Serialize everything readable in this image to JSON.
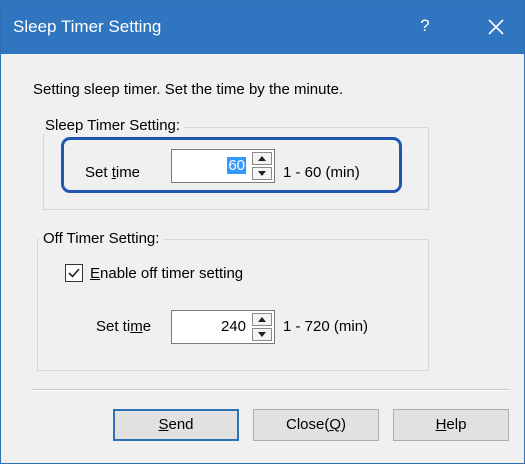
{
  "window": {
    "title": "Sleep Timer Setting",
    "help_glyph": "?",
    "close_icon": "close-icon"
  },
  "description": "Setting sleep timer. Set the time by the minute.",
  "sleep_group": {
    "label": "Sleep Timer Setting:",
    "set_time_label_pre": "Set ",
    "set_time_label_mnemonic": "t",
    "set_time_label_post": "ime",
    "value": "60",
    "range": "1 - 60 (min)"
  },
  "off_group": {
    "label": "Off Timer Setting:",
    "checkbox_checked": true,
    "checkbox_mnemonic": "E",
    "checkbox_label_rest": "nable off timer setting",
    "set_time_label_pre": "Set ti",
    "set_time_label_mnemonic": "m",
    "set_time_label_post": "e",
    "value": "240",
    "range": "1 - 720 (min)"
  },
  "buttons": {
    "send_mnemonic": "S",
    "send_rest": "end",
    "close_pre": "Close(",
    "close_mnemonic": "Q",
    "close_post": ")",
    "help_mnemonic": "H",
    "help_rest": "elp"
  },
  "colors": {
    "titlebar": "#2f75c0",
    "highlight": "#1f56b0",
    "selection": "#3399ff"
  }
}
